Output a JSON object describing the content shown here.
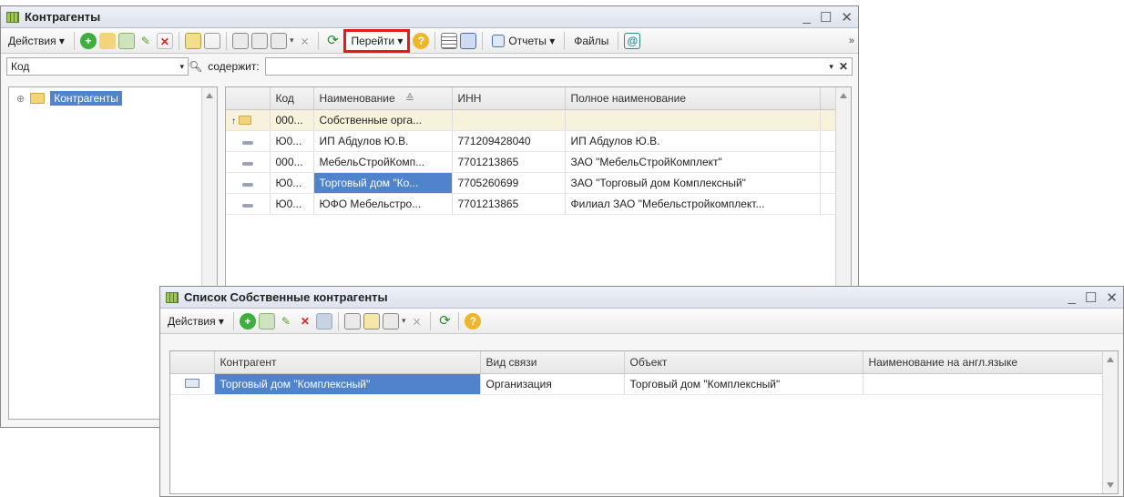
{
  "main_window": {
    "title": "Контрагенты",
    "toolbar": {
      "actions_label": "Действия",
      "goto_label": "Перейти",
      "reports_label": "Отчеты",
      "files_label": "Файлы"
    },
    "filter": {
      "field_value": "Код",
      "condition_label": "содержит:",
      "search_value": ""
    },
    "tree": {
      "root_label": "Контрагенты"
    },
    "table": {
      "columns": [
        "Код",
        "Наименование",
        "ИНН",
        "Полное наименование"
      ],
      "group_row": {
        "code": "000...",
        "name": "Собственные орга...",
        "inn": "",
        "full": ""
      },
      "rows": [
        {
          "code": "Ю0...",
          "name": "ИП Абдулов Ю.В.",
          "inn": "771209428040",
          "full": "ИП Абдулов Ю.В."
        },
        {
          "code": "000...",
          "name": "МебельСтройКомп...",
          "inn": "7701213865",
          "full": "ЗАО \"МебельСтройКомплект\""
        },
        {
          "code": "Ю0...",
          "name": "Торговый дом \"Ко...",
          "inn": "7705260699",
          "full": "ЗАО \"Торговый дом Комплексный\""
        },
        {
          "code": "Ю0...",
          "name": "ЮФО Мебельстро...",
          "inn": "7701213865",
          "full": "Филиал ЗАО \"Мебельстройкомплект..."
        }
      ]
    }
  },
  "sub_window": {
    "title": "Список Собственные контрагенты",
    "toolbar": {
      "actions_label": "Действия"
    },
    "table": {
      "columns": [
        "Контрагент",
        "Вид связи",
        "Объект",
        "Наименование на англ.языке"
      ],
      "rows": [
        {
          "contractor": "Торговый дом \"Комплексный\"",
          "link_type": "Организация",
          "object": "Торговый дом \"Комплексный\"",
          "eng_name": ""
        }
      ]
    }
  },
  "colors": {
    "selection": "#4f83cc",
    "highlight_border": "#e31b1b",
    "group_row": "#f7f2dc"
  }
}
